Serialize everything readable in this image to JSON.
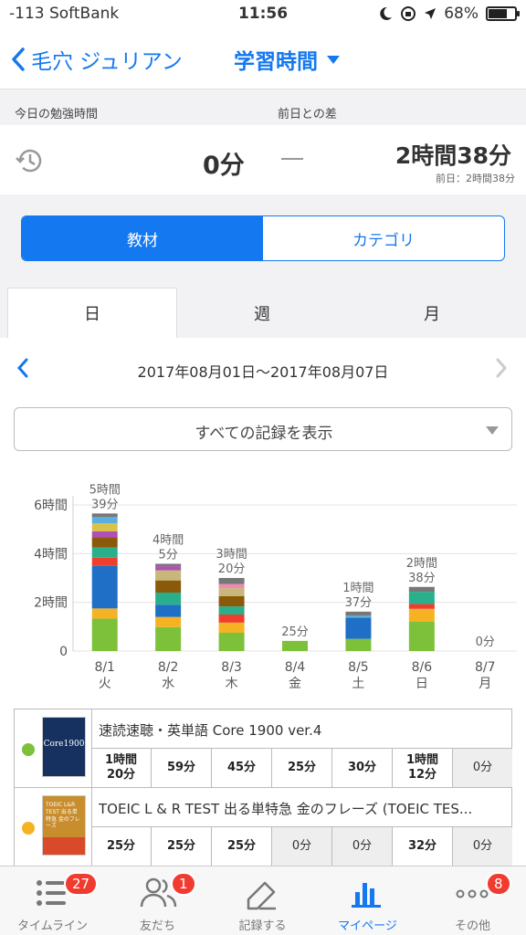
{
  "status": {
    "carrier": "-113 SoftBank",
    "time": "11:56",
    "battery": "68%"
  },
  "nav": {
    "back_label": "毛穴 ジュリアン",
    "title": "学習時間"
  },
  "summary": {
    "today_label": "今日の勉強時間",
    "diff_label": "前日との差",
    "today_value": "0分",
    "diff_value": "2時間38分",
    "prev_day": "前日：2時間38分"
  },
  "segment": {
    "left": "教材",
    "right": "カテゴリ"
  },
  "period_tabs": [
    "日",
    "週",
    "月"
  ],
  "date_range": "2017年08月01日〜2017年08月07日",
  "filter": {
    "label": "すべての記録を表示"
  },
  "chart_data": {
    "type": "bar",
    "stacked": true,
    "categories": [
      "8/1",
      "8/2",
      "8/3",
      "8/4",
      "8/5",
      "8/6",
      "8/7"
    ],
    "weekdays": [
      "火",
      "水",
      "木",
      "金",
      "土",
      "日",
      "月"
    ],
    "totals_minutes": [
      339,
      245,
      200,
      25,
      97,
      158,
      0
    ],
    "total_labels": [
      [
        "5時間",
        "39分"
      ],
      [
        "4時間",
        "5分"
      ],
      [
        "3時間",
        "20分"
      ],
      [
        "25分"
      ],
      [
        "1時間",
        "37分"
      ],
      [
        "2時間",
        "38分"
      ],
      [
        "0分"
      ]
    ],
    "y_ticks": [
      {
        "value": 0,
        "label": "0"
      },
      {
        "value": 120,
        "label": "2時間"
      },
      {
        "value": 240,
        "label": "4時間"
      },
      {
        "value": 360,
        "label": "6時間"
      }
    ],
    "ylim": [
      0,
      360
    ],
    "grid": true,
    "series": [
      {
        "color": "#7dc13a",
        "values": [
          80,
          59,
          45,
          25,
          30,
          72,
          0
        ]
      },
      {
        "color": "#f5b324",
        "values": [
          25,
          25,
          25,
          0,
          0,
          32,
          0
        ]
      },
      {
        "color": "#1f6fc6",
        "values": [
          105,
          30,
          0,
          0,
          52,
          0,
          0
        ]
      },
      {
        "color": "#f03e2d",
        "values": [
          20,
          0,
          20,
          0,
          0,
          12,
          0
        ]
      },
      {
        "color": "#2aaf8c",
        "values": [
          25,
          30,
          20,
          0,
          0,
          30,
          0
        ]
      },
      {
        "color": "#8a5a0a",
        "values": [
          25,
          30,
          25,
          0,
          0,
          0,
          0
        ]
      },
      {
        "color": "#c8b67a",
        "values": [
          0,
          25,
          20,
          0,
          0,
          0,
          0
        ]
      },
      {
        "color": "#b14fb5",
        "values": [
          15,
          10,
          0,
          0,
          0,
          0,
          0
        ]
      },
      {
        "color": "#f08ab0",
        "values": [
          0,
          0,
          10,
          0,
          0,
          0,
          0
        ]
      },
      {
        "color": "#d9c24a",
        "values": [
          20,
          0,
          0,
          0,
          0,
          0,
          0
        ]
      },
      {
        "color": "#5aaee0",
        "values": [
          15,
          0,
          0,
          0,
          5,
          0,
          0
        ]
      },
      {
        "color": "#777777",
        "values": [
          9,
          6,
          15,
          0,
          10,
          12,
          0
        ]
      }
    ]
  },
  "materials": [
    {
      "name": "速読速聴・英単語 Core 1900 ver.4",
      "dot_color": "#7dc13a",
      "book_title": "Core1900",
      "times": [
        "1時間\n20分",
        "59分",
        "45分",
        "25分",
        "30分",
        "1時間\n12分",
        "0分"
      ]
    },
    {
      "name": "TOEIC L & R TEST 出る単特急 金のフレーズ (TOEIC TES...",
      "dot_color": "#f5b324",
      "book_title": "TOEIC L&R TEST 出る単特急 金のフレーズ",
      "times": [
        "25分",
        "25分",
        "25分",
        "0分",
        "0分",
        "32分",
        "0分"
      ]
    }
  ],
  "tabbar": {
    "items": [
      {
        "label": "タイムライン",
        "badge": "27"
      },
      {
        "label": "友だち",
        "badge": "1"
      },
      {
        "label": "記録する",
        "badge": ""
      },
      {
        "label": "マイページ",
        "badge": ""
      },
      {
        "label": "その他",
        "badge": "8"
      }
    ]
  }
}
